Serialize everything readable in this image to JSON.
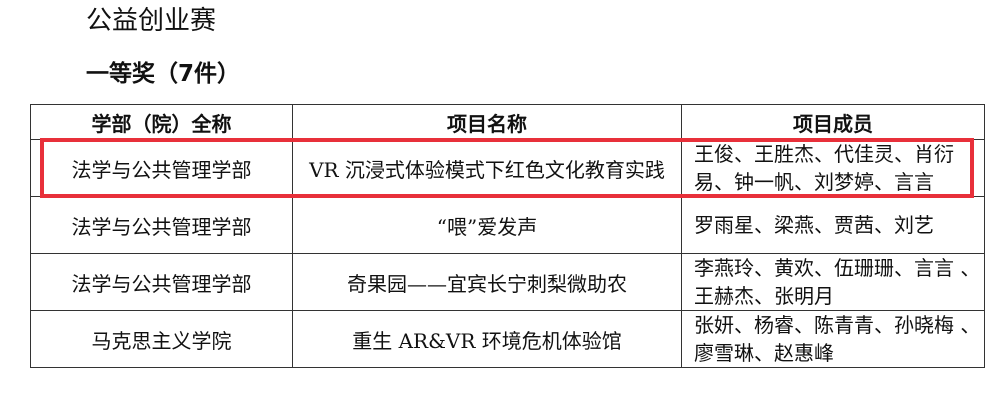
{
  "section_title": "公益创业赛",
  "award_title": "一等奖（7件）",
  "table": {
    "headers": [
      "学部（院）全称",
      "项目名称",
      "项目成员"
    ],
    "rows": [
      {
        "department": "法学与公共管理学部",
        "project": "VR 沉浸式体验模式下红色文化教育实践",
        "members": "王俊、王胜杰、代佳灵、肖衍易、钟一帆、刘梦婷、言言"
      },
      {
        "department": "法学与公共管理学部",
        "project": "“喂”爱发声",
        "members": "罗雨星、梁燕、贾茜、刘艺"
      },
      {
        "department": "法学与公共管理学部",
        "project": "奇果园——宜宾长宁刺梨微助农",
        "members": "李燕玲、黄欢、伍珊珊、言言 、王赫杰、张明月"
      },
      {
        "department": "马克思主义学院",
        "project": "重生 AR&VR 环境危机体验馆",
        "members": "张妍、杨睿、陈青青、孙晓梅 、廖雪琳、赵惠峰"
      }
    ]
  },
  "highlight_color": "#e8303a"
}
